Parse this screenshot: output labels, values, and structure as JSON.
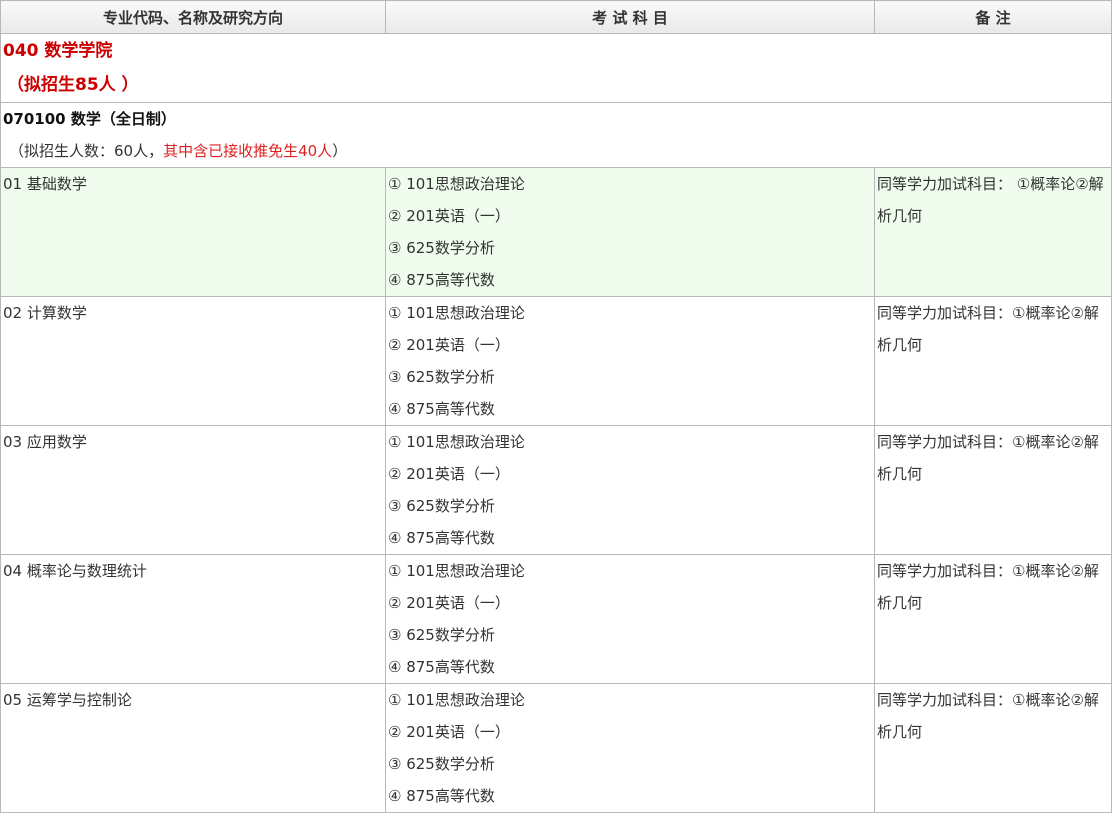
{
  "header": {
    "col1": "专业代码、名称及研究方向",
    "col2": "考 试 科 目",
    "col3": "备 注"
  },
  "college": {
    "name": "040 数学学院",
    "quota": "（拟招生85人 ）"
  },
  "major": {
    "name": "070100 数学（全日制）",
    "quota_prefix": "（拟招生人数：60人，",
    "quota_highlight": "其中含已接收推免生40人",
    "quota_suffix": "）"
  },
  "directions": [
    {
      "name": "01 基础数学",
      "exams": [
        "① 101思想政治理论",
        "② 201英语（一）",
        "③ 625数学分析",
        "④ 875高等代数"
      ],
      "remark": "同等学力加试科目： ①概率论②解析几何"
    },
    {
      "name": "02 计算数学",
      "exams": [
        "① 101思想政治理论",
        "② 201英语（一）",
        "③ 625数学分析",
        "④ 875高等代数"
      ],
      "remark": "同等学力加试科目：①概率论②解析几何"
    },
    {
      "name": "03 应用数学",
      "exams": [
        "① 101思想政治理论",
        "② 201英语（一）",
        "③ 625数学分析",
        "④ 875高等代数"
      ],
      "remark": "同等学力加试科目：①概率论②解析几何"
    },
    {
      "name": "04 概率论与数理统计",
      "exams": [
        "① 101思想政治理论",
        "② 201英语（一）",
        "③ 625数学分析",
        "④ 875高等代数"
      ],
      "remark": "同等学力加试科目：①概率论②解析几何"
    },
    {
      "name": "05 运筹学与控制论",
      "exams": [
        "① 101思想政治理论",
        "② 201英语（一）",
        "③ 625数学分析",
        "④ 875高等代数"
      ],
      "remark": "同等学力加试科目：①概率论②解析几何"
    }
  ]
}
